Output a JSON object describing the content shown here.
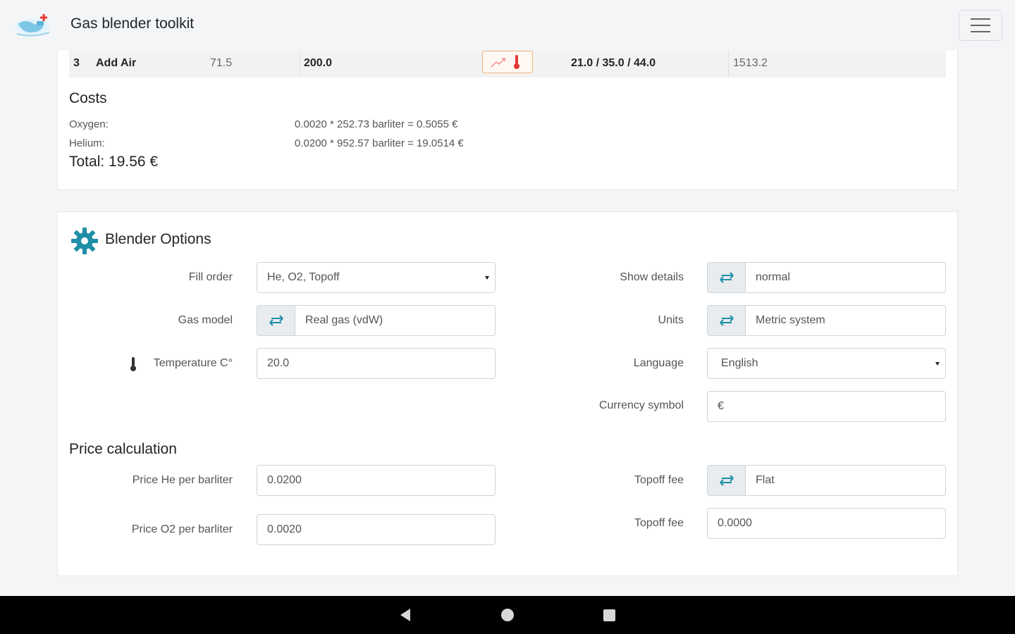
{
  "app": {
    "title": "Gas blender toolkit"
  },
  "mix_row": {
    "step": "3",
    "action": "Add Air",
    "start": "71.5",
    "end": "200.0",
    "mix": "21.0 / 35.0 / 44.0",
    "liters": "1513.2"
  },
  "costs": {
    "title": "Costs",
    "oxygen_label": "Oxygen:",
    "oxygen_value": "0.0020 * 252.73 barliter = 0.5055 €",
    "helium_label": "Helium:",
    "helium_value": "0.0200 * 952.57 barliter = 19.0514 €",
    "total": "Total: 19.56 €"
  },
  "options": {
    "title": "Blender Options",
    "fill_order_label": "Fill order",
    "fill_order_value": "He, O2, Topoff",
    "gas_model_label": "Gas model",
    "gas_model_value": "Real gas (vdW)",
    "temperature_label": "Temperature C°",
    "temperature_value": "20.0",
    "show_details_label": "Show details",
    "show_details_value": "normal",
    "units_label": "Units",
    "units_value": "Metric system",
    "language_label": "Language",
    "language_value": "English",
    "currency_label": "Currency symbol",
    "currency_value": "€"
  },
  "price": {
    "title": "Price calculation",
    "he_label": "Price He per barliter",
    "he_value": "0.0200",
    "o2_label": "Price O2 per barliter",
    "o2_value": "0.0020",
    "topoff_fee_type_label": "Topoff fee",
    "topoff_fee_type_value": "Flat",
    "topoff_fee_label": "Topoff fee",
    "topoff_fee_value": "0.0000"
  },
  "colors": {
    "accent": "#1f8fa8",
    "warning": "#e53935"
  }
}
